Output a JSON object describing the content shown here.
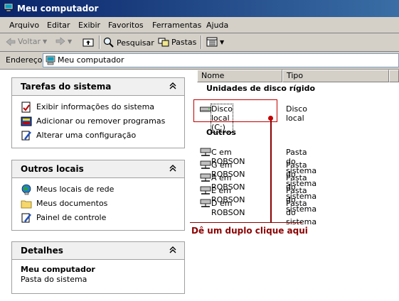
{
  "window": {
    "title": "Meu computador"
  },
  "menu": [
    "Arquivo",
    "Editar",
    "Exibir",
    "Favoritos",
    "Ferramentas",
    "Ajuda"
  ],
  "toolbar": {
    "back": "Voltar",
    "search": "Pesquisar",
    "folders": "Pastas"
  },
  "address": {
    "label": "Endereço",
    "value": "Meu computador"
  },
  "tasks": {
    "title": "Tarefas do sistema",
    "items": [
      "Exibir informações do sistema",
      "Adicionar ou remover programas",
      "Alterar uma configuração"
    ]
  },
  "places": {
    "title": "Outros locais",
    "items": [
      "Meus locais de rede",
      "Meus documentos",
      "Painel de controle"
    ]
  },
  "details": {
    "title": "Detalhes",
    "name": "Meu computador",
    "type": "Pasta do sistema"
  },
  "columns": {
    "name": "Nome",
    "type": "Tipo"
  },
  "groups": {
    "hard_disks": "Unidades de disco rígido",
    "others": "Outros"
  },
  "disk": {
    "name": "Disco local (C:)",
    "type": "Disco local"
  },
  "network_drives": [
    {
      "name": "C em ROBSON",
      "type": "Pasta do sistema"
    },
    {
      "name": "G em ROBSON",
      "type": "Pasta do sistema"
    },
    {
      "name": "A em ROBSON",
      "type": "Pasta do sistema"
    },
    {
      "name": "E em ROBSON",
      "type": "Pasta do sistema"
    },
    {
      "name": "D em ROBSON",
      "type": "Pasta do sistema"
    }
  ],
  "annotation": "Dê um duplo clique aqui"
}
